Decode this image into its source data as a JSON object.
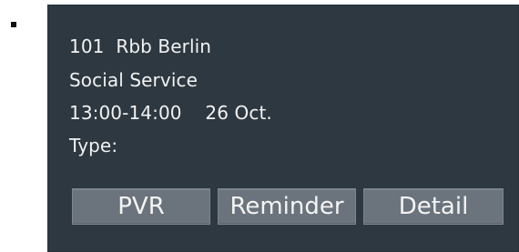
{
  "program": {
    "channel_line": "101  Rbb Berlin",
    "title": "Social Service",
    "time_line": "13:00-14:00    26 Oct.",
    "type_label": "Type:"
  },
  "actions": {
    "pvr_label": "PVR",
    "reminder_label": "Reminder",
    "detail_label": "Detail"
  },
  "colors": {
    "panel_bg": "#2d3840",
    "button_bg": "#6b747c",
    "text": "#f2f2f2"
  }
}
